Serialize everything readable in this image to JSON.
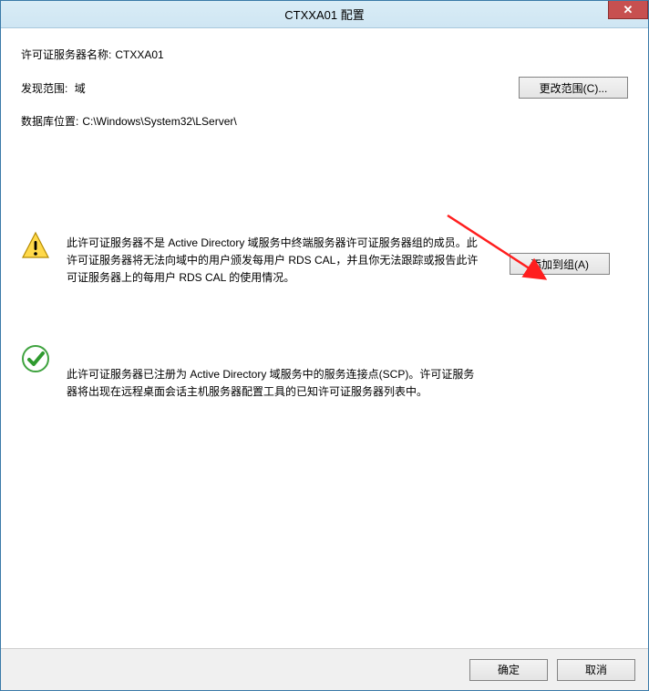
{
  "title": "CTXXA01 配置",
  "header": {
    "server_name_label": "许可证服务器名称:",
    "server_name_value": "CTXXA01",
    "scope_label": "发现范围:",
    "scope_value": "域",
    "change_scope_button": "更改范围(C)...",
    "db_location_label": "数据库位置:",
    "db_location_value": "C:\\Windows\\System32\\LServer\\"
  },
  "warning": {
    "text": "此许可证服务器不是 Active Directory 域服务中终端服务器许可证服务器组的成员。此许可证服务器将无法向域中的用户颁发每用户 RDS CAL，并且你无法跟踪或报告此许可证服务器上的每用户 RDS CAL 的使用情况。",
    "button": "添加到组(A)"
  },
  "success": {
    "text": "此许可证服务器已注册为 Active Directory 域服务中的服务连接点(SCP)。许可证服务器将出现在远程桌面会话主机服务器配置工具的已知许可证服务器列表中。"
  },
  "footer": {
    "ok": "确定",
    "cancel": "取消"
  }
}
